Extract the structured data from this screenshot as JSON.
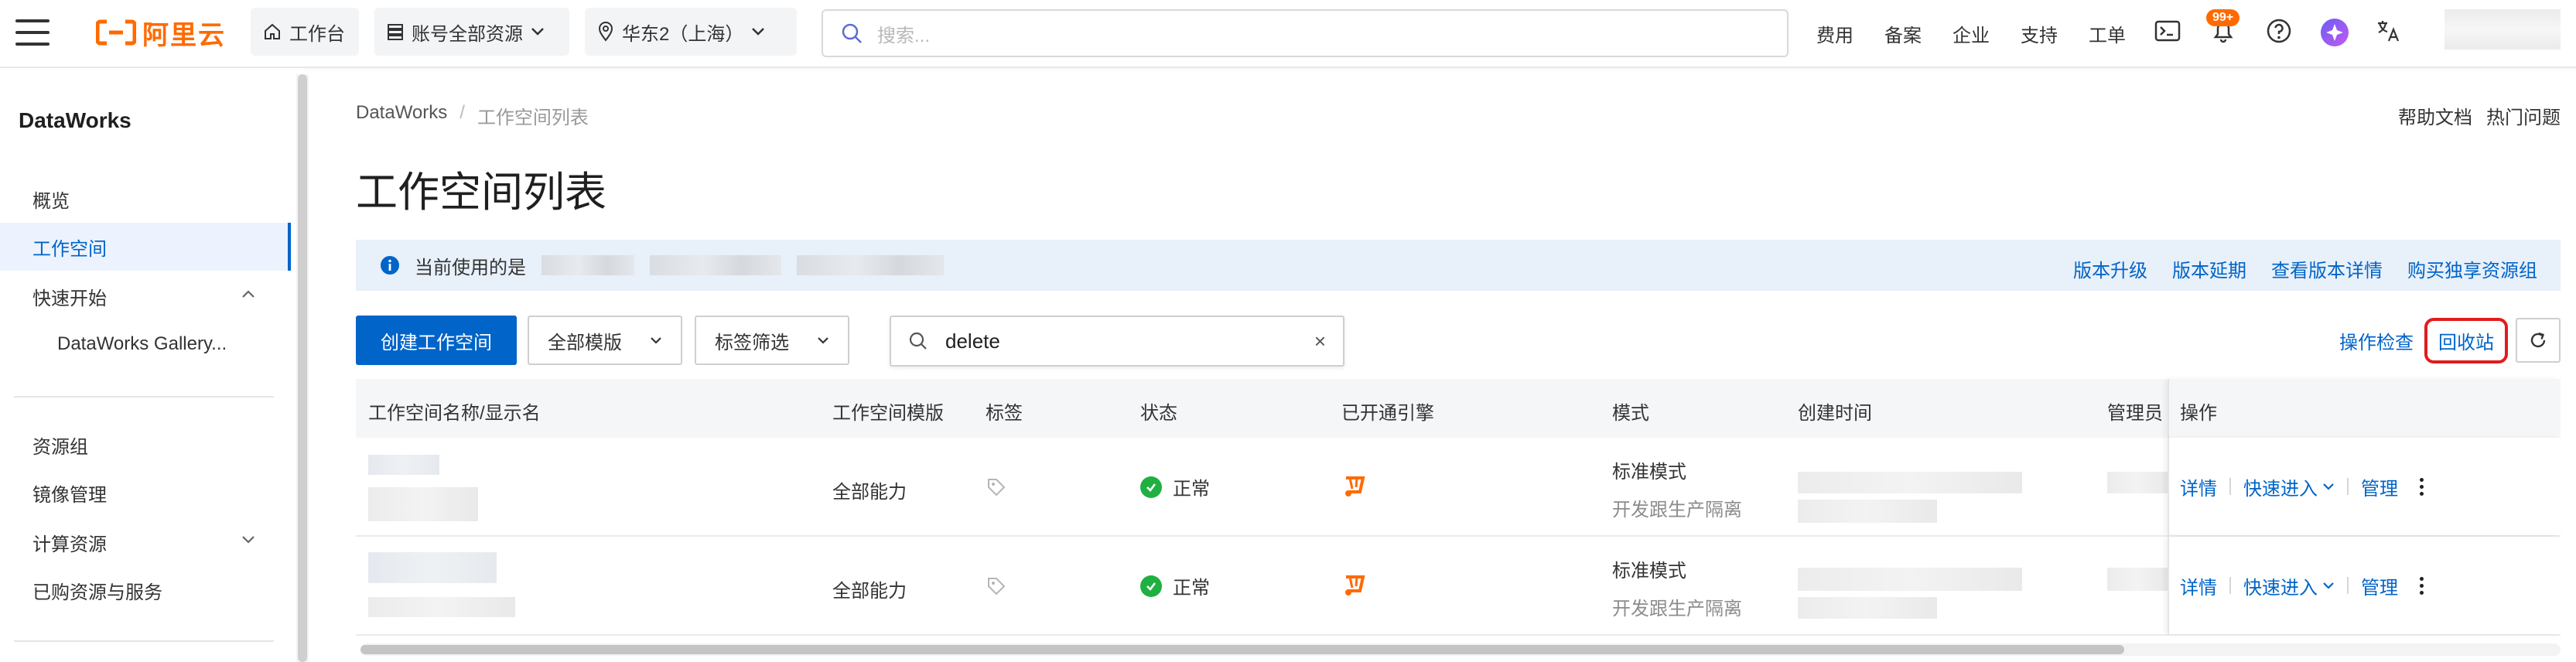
{
  "topbar": {
    "logo_text": "阿里云",
    "workbench": "工作台",
    "resources": "账号全部资源",
    "region": "华东2（上海）",
    "search_placeholder": "搜索...",
    "links": [
      "费用",
      "备案",
      "企业",
      "支持",
      "工单"
    ],
    "badge": "99+"
  },
  "sidebar": {
    "title": "DataWorks",
    "items": [
      {
        "label": "概览"
      },
      {
        "label": "工作空间",
        "active": true
      },
      {
        "label": "快速开始"
      },
      {
        "label": "DataWorks Gallery..."
      },
      {
        "label": "资源组"
      },
      {
        "label": "镜像管理"
      },
      {
        "label": "计算资源"
      },
      {
        "label": "已购资源与服务"
      }
    ]
  },
  "breadcrumb": [
    "DataWorks",
    "工作空间列表"
  ],
  "help": [
    "帮助文档",
    "热门问题"
  ],
  "page_title": "工作空间列表",
  "notice": {
    "text": "当前使用的是",
    "links": [
      "版本升级",
      "版本延期",
      "查看版本详情",
      "购买独享资源组"
    ]
  },
  "toolbar": {
    "create": "创建工作空间",
    "template_select": "全部模版",
    "tag_select": "标签筛选",
    "search_value": "delete",
    "ops_check": "操作检查",
    "recycle": "回收站"
  },
  "table": {
    "columns": [
      "工作空间名称/显示名",
      "工作空间模版",
      "标签",
      "状态",
      "已开通引擎",
      "模式",
      "创建时间",
      "管理员",
      "操作"
    ],
    "rows": [
      {
        "template": "全部能力",
        "status": "正常",
        "mode": "标准模式",
        "mode_sub": "开发跟生产隔离"
      },
      {
        "template": "全部能力",
        "status": "正常",
        "mode": "标准模式",
        "mode_sub": "开发跟生产隔离"
      }
    ],
    "actions": {
      "detail": "详情",
      "quick": "快速进入",
      "manage": "管理"
    }
  },
  "colors": {
    "brand": "#ff6a00",
    "primary": "#0064c8",
    "success": "#1fb041",
    "highlight": "#e21c1c"
  }
}
